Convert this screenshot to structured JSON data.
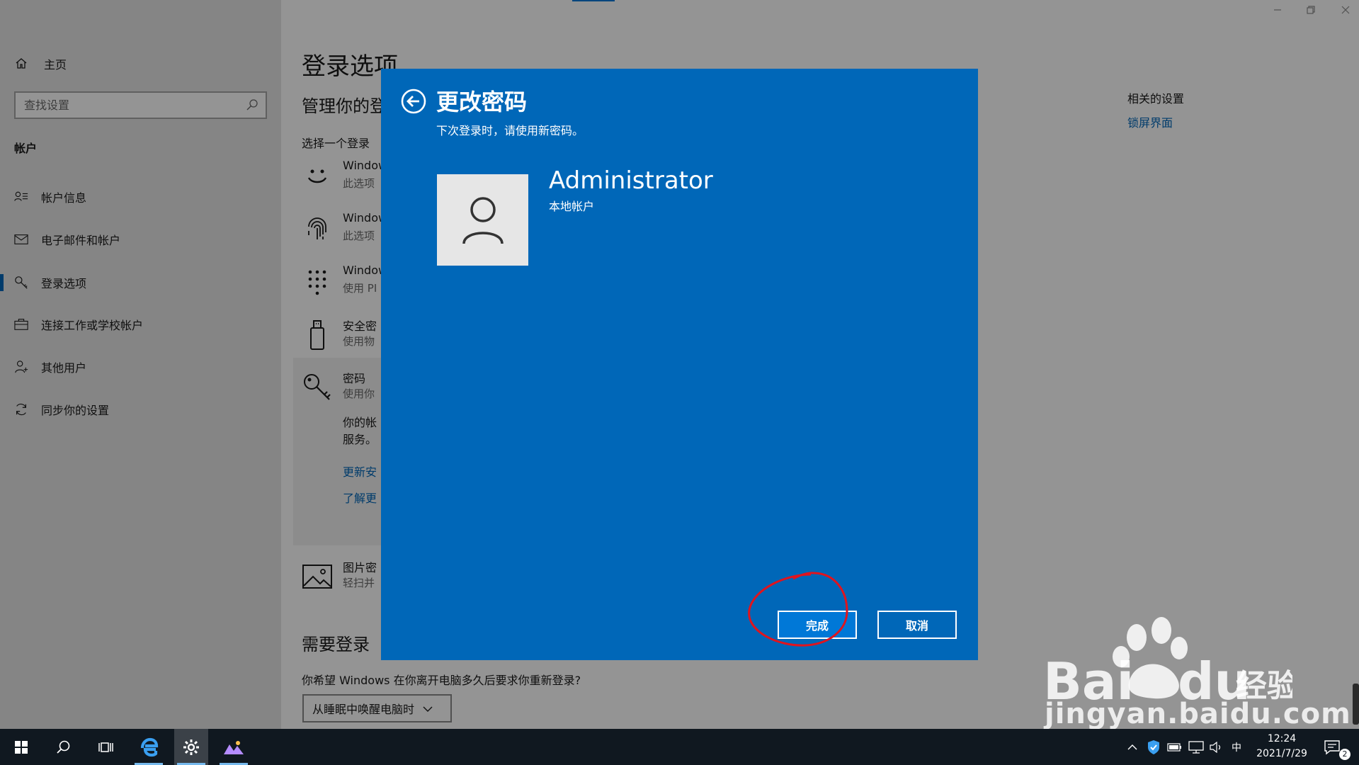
{
  "window": {
    "title": "设置"
  },
  "sidebar": {
    "home_label": "主页",
    "search_placeholder": "查找设置",
    "section_label": "帐户",
    "items": [
      {
        "label": "帐户信息",
        "icon": "account-info-icon"
      },
      {
        "label": "电子邮件和帐户",
        "icon": "mail-icon"
      },
      {
        "label": "登录选项",
        "icon": "key-icon",
        "active": true
      },
      {
        "label": "连接工作或学校帐户",
        "icon": "briefcase-icon"
      },
      {
        "label": "其他用户",
        "icon": "person-add-icon"
      },
      {
        "label": "同步你的设置",
        "icon": "sync-icon"
      }
    ]
  },
  "main": {
    "title": "登录选项",
    "subtitle": "管理你的登录",
    "select_hint": "选择一个登录",
    "options": [
      {
        "title": "Windows",
        "desc": "此选项",
        "icon": "face-icon"
      },
      {
        "title": "Windows",
        "desc": "此选项",
        "icon": "fingerprint-icon"
      },
      {
        "title": "Windows",
        "desc": "使用 PI",
        "icon": "pin-keypad-icon"
      },
      {
        "title": "安全密",
        "desc": "使用物",
        "icon": "usb-key-icon"
      },
      {
        "title": "密码",
        "desc": "使用你",
        "icon": "password-key-icon"
      }
    ],
    "password_body_1": "你的帐",
    "password_body_2": "服务。",
    "password_link_1": "更新安",
    "password_link_2": "了解更",
    "picture_option": {
      "title": "图片密",
      "desc": "轻扫并",
      "icon": "picture-icon"
    },
    "require_login_heading": "需要登录",
    "require_login_question": "你希望 Windows 在你离开电脑多久后要求你重新登录?",
    "require_login_value": "从睡眠中唤醒电脑时"
  },
  "related": {
    "title": "相关的设置",
    "link": "锁屏界面"
  },
  "dialog": {
    "title": "更改密码",
    "subtitle": "下次登录时，请使用新密码。",
    "user_name": "Administrator",
    "user_type": "本地帐户",
    "finish_label": "完成",
    "cancel_label": "取消"
  },
  "watermark": {
    "text": "jingyan.baidu.com"
  },
  "taskbar": {
    "time": "12:24",
    "date": "2021/7/29",
    "ime": "中",
    "notification_count": "2"
  },
  "colors": {
    "accent": "#0067b8",
    "dialog_bg": "#0067b8",
    "taskbar_bg": "#101820",
    "annotation": "#e0141e"
  }
}
